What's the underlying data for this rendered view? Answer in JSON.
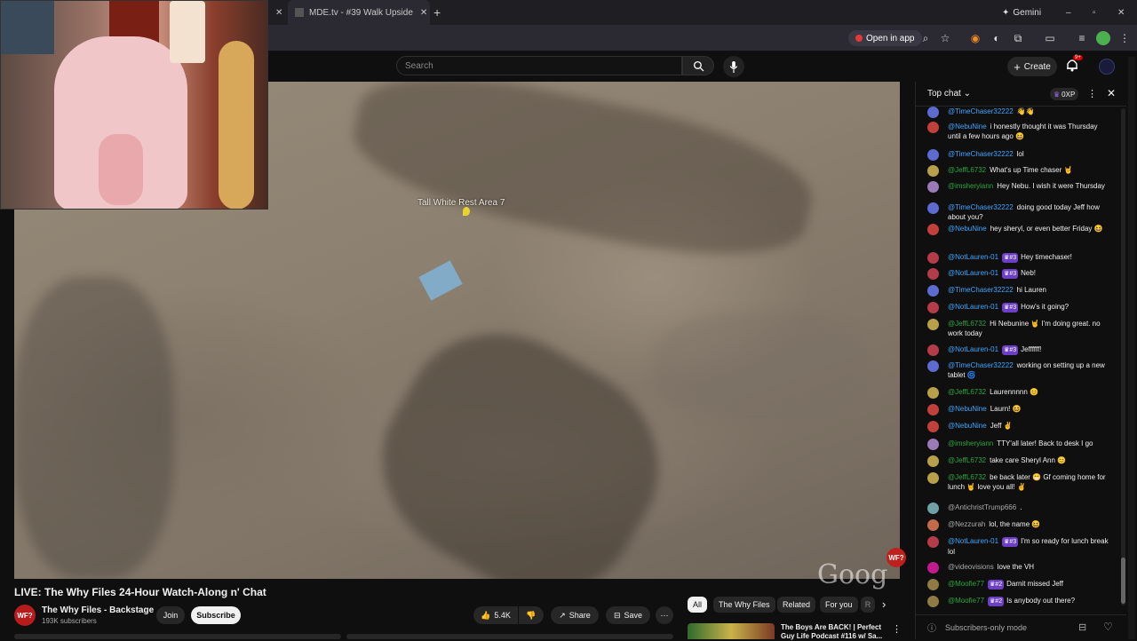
{
  "browser": {
    "tab_title": "MDE.tv - #39 Walk Upside",
    "new_tab_label": "+",
    "gemini_label": "Gemini",
    "open_in_app_label": "Open in app"
  },
  "masthead": {
    "search_placeholder": "Search",
    "create_label": "Create",
    "notification_count": "9+"
  },
  "video": {
    "placemark_text": "Tall White Rest Area 7",
    "watermark": "Goog",
    "badge": "WF?"
  },
  "below": {
    "title": "LIVE: The Why Files 24-Hour Watch-Along n' Chat",
    "channel_avatar_text": "WF?",
    "channel_name": "The Why Files - Backstage",
    "subscribers": "193K subscribers",
    "join_label": "Join",
    "subscribe_label": "Subscribe",
    "like_count": "5.4K",
    "share_label": "Share",
    "save_label": "Save",
    "chips": [
      "All",
      "The Why Files",
      "Related",
      "For you",
      "R"
    ],
    "rec_title_line1": "The Boys Are BACK! | Perfect",
    "rec_title_line2": "Guy Life Podcast #116 w/ Sa..."
  },
  "chat": {
    "header_title": "Top chat",
    "xp_label": "0XP",
    "footer_label": "Subscribers-only mode",
    "messages": [
      {
        "author": "@TimeChaser32222",
        "badge": "",
        "text": "👋👋",
        "color": "#3ea6ff",
        "av": "#5d6bd1"
      },
      {
        "author": "@NebuNine",
        "badge": "",
        "text": "i honestly thought it was Thursday until a few hours ago 😆",
        "color": "#3ea6ff",
        "av": "#c2403a"
      },
      {
        "author": "@TimeChaser32222",
        "badge": "",
        "text": "lol",
        "color": "#3ea6ff",
        "av": "#5d6bd1"
      },
      {
        "author": "@JeffL6732",
        "badge": "",
        "text": "What's up Time chaser 🤘",
        "color": "#2ba640",
        "av": "#b8a04a"
      },
      {
        "author": "@imsheryiann",
        "badge": "",
        "text": "Hey Nebu. I wish it were Thursday",
        "color": "#2ba640",
        "av": "#9b7ab8"
      },
      {
        "author": "@TimeChaser32222",
        "badge": "",
        "text": "doing good today Jeff how about you?",
        "color": "#3ea6ff",
        "av": "#5d6bd1"
      },
      {
        "author": "@NebuNine",
        "badge": "",
        "text": "hey sheryl, or even better Friday 😆",
        "color": "#3ea6ff",
        "av": "#c2403a"
      },
      {
        "author": "@NotLauren-01",
        "badge": "#3",
        "text": "Hey timechaser!",
        "color": "#3ea6ff",
        "av": "#b43c48"
      },
      {
        "author": "@NotLauren-01",
        "badge": "#3",
        "text": "Neb!",
        "color": "#3ea6ff",
        "av": "#b43c48"
      },
      {
        "author": "@TimeChaser32222",
        "badge": "",
        "text": "hi Lauren",
        "color": "#3ea6ff",
        "av": "#5d6bd1"
      },
      {
        "author": "@NotLauren-01",
        "badge": "#3",
        "text": "How's it going?",
        "color": "#3ea6ff",
        "av": "#b43c48"
      },
      {
        "author": "@JeffL6732",
        "badge": "",
        "text": "Hi Nebunine 🤘 I'm doing great. no work today",
        "color": "#2ba640",
        "av": "#b8a04a"
      },
      {
        "author": "@NotLauren-01",
        "badge": "#3",
        "text": "Jeffffff!",
        "color": "#3ea6ff",
        "av": "#b43c48"
      },
      {
        "author": "@TimeChaser32222",
        "badge": "",
        "text": "working on setting up a new tablet 🌀",
        "color": "#3ea6ff",
        "av": "#5d6bd1"
      },
      {
        "author": "@JeffL6732",
        "badge": "",
        "text": "Laurennnnn 😊",
        "color": "#2ba640",
        "av": "#b8a04a"
      },
      {
        "author": "@NebuNine",
        "badge": "",
        "text": "Laurn! 😆",
        "color": "#3ea6ff",
        "av": "#c2403a"
      },
      {
        "author": "@NebuNine",
        "badge": "",
        "text": "Jeff ✌",
        "color": "#3ea6ff",
        "av": "#c2403a"
      },
      {
        "author": "@imsheryiann",
        "badge": "",
        "text": "TTY'all later! Back to desk I go",
        "color": "#2ba640",
        "av": "#9b7ab8"
      },
      {
        "author": "@JeffL6732",
        "badge": "",
        "text": "take care Sheryl Ann 😊",
        "color": "#2ba640",
        "av": "#b8a04a"
      },
      {
        "author": "@JeffL6732",
        "badge": "",
        "text": "be back later 😁 Gf coming home for lunch 🤘 love you all! ✌",
        "color": "#2ba640",
        "av": "#b8a04a"
      },
      {
        "author": "@AntichristTrump666",
        "badge": "",
        "text": ".",
        "color": "#aaaaaa",
        "av": "#6fa0a8"
      },
      {
        "author": "@Nezzurah",
        "badge": "",
        "text": "lol, the name 😆",
        "color": "#aaaaaa",
        "av": "#c26a4a"
      },
      {
        "author": "@NotLauren-01",
        "badge": "#3",
        "text": "I'm so ready for lunch break lol",
        "color": "#3ea6ff",
        "av": "#b43c48"
      },
      {
        "author": "@videovisions",
        "badge": "",
        "text": "love the VH",
        "color": "#aaaaaa",
        "av": "#c21b8f"
      },
      {
        "author": "@Moofie77",
        "badge": "#2",
        "text": "Darnit missed Jeff",
        "color": "#2ba640",
        "av": "#8f7a43"
      },
      {
        "author": "@Moofie77",
        "badge": "#2",
        "text": "Is anybody out there?",
        "color": "#2ba640",
        "av": "#8f7a43"
      }
    ]
  }
}
